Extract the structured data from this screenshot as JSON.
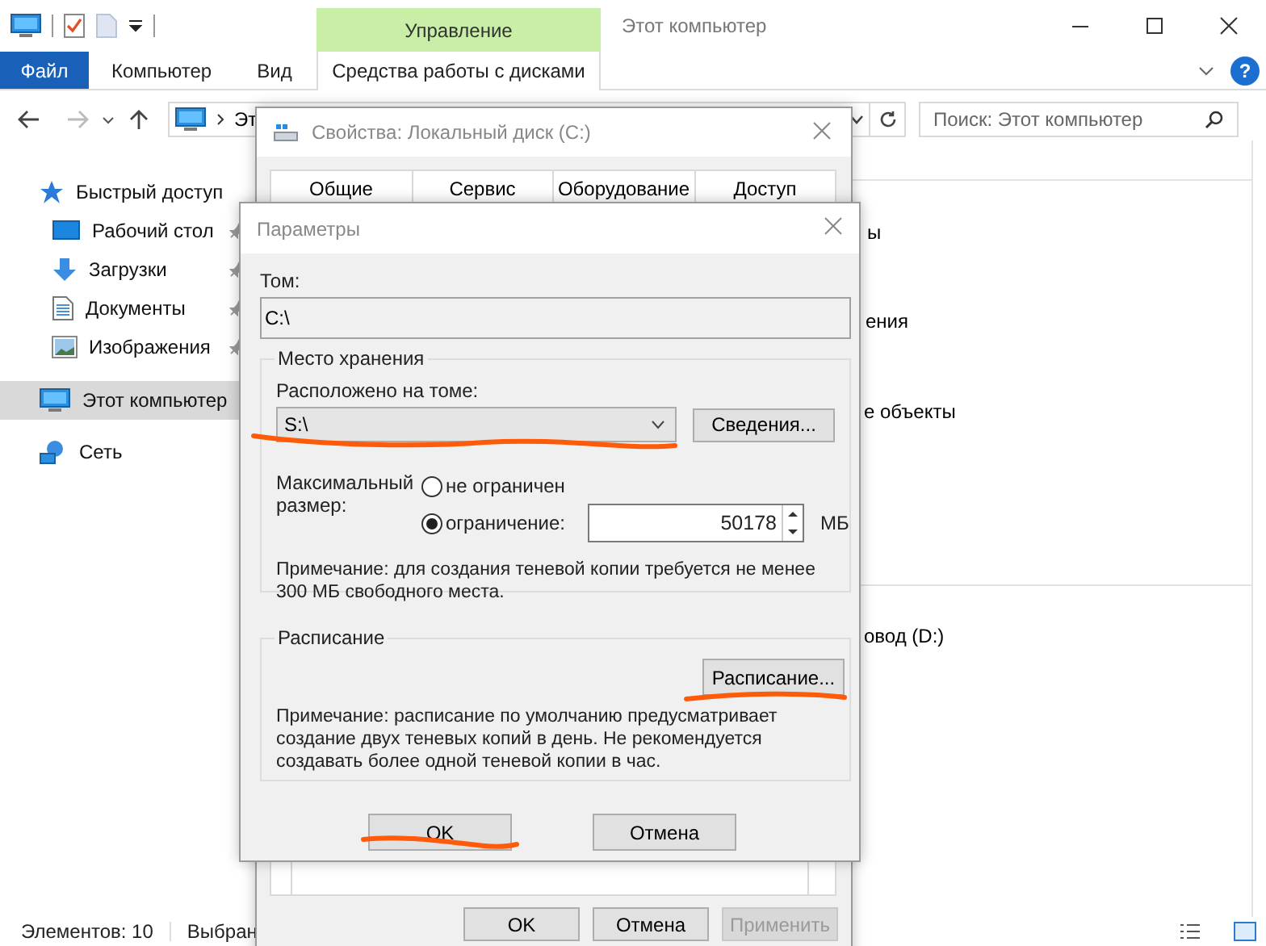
{
  "explorer": {
    "title": "Этот компьютер",
    "context_group": "Управление",
    "ribbon_tabs": [
      {
        "label": "Файл",
        "kind": "file"
      },
      {
        "label": "Компьютер",
        "kind": "tab"
      },
      {
        "label": "Вид",
        "kind": "tab"
      },
      {
        "label": "Средства работы с дисками",
        "kind": "context"
      }
    ],
    "help": "?",
    "address": {
      "crumb": "Эт"
    },
    "search": {
      "placeholder": "Поиск: Этот компьютер"
    },
    "nav": [
      {
        "label": "Быстрый доступ",
        "selected": false,
        "children": [
          {
            "label": "Рабочий стол",
            "selected": false,
            "pinned": true
          },
          {
            "label": "Загрузки",
            "selected": false,
            "pinned": true
          },
          {
            "label": "Документы",
            "selected": false,
            "pinned": true
          },
          {
            "label": "Изображения",
            "selected": false,
            "pinned": true
          }
        ]
      },
      {
        "label": "Этот компьютер",
        "selected": true
      },
      {
        "label": "Сеть",
        "selected": false
      }
    ],
    "content_fragments": [
      "ы",
      "ения",
      "е объекты",
      "овод (D:)"
    ],
    "status": {
      "count": "Элементов: 10",
      "selection": "Выбран"
    }
  },
  "properties_dialog": {
    "title": "Свойства: Локальный диск (C:)",
    "tabs": [
      {
        "label": "Общие"
      },
      {
        "label": "Сервис"
      },
      {
        "label": "Оборудование"
      },
      {
        "label": "Доступ"
      }
    ],
    "buttons": [
      {
        "label": "OK",
        "disabled": false
      },
      {
        "label": "Отмена",
        "disabled": false
      },
      {
        "label": "Применить",
        "disabled": true
      }
    ]
  },
  "params_dialog": {
    "title": "Параметры",
    "volume_label": "Том:",
    "volume": "C:\\",
    "storage": {
      "title": "Место хранения",
      "location_label": "Расположено на томе:",
      "location": "S:\\",
      "details_button": "Сведения...",
      "max_label": "Максимальный размер:",
      "options": [
        {
          "label": "не ограничен",
          "selected": false
        },
        {
          "label": "ограничение:",
          "selected": true
        }
      ],
      "limit": "50178",
      "unit": "МБ",
      "note": "Примечание: для создания теневой копии требуется не менее 300 МБ свободного места."
    },
    "schedule": {
      "title": "Расписание",
      "button": "Расписание...",
      "note": "Примечание: расписание по умолчанию предусматривает создание двух теневых копий в день. Не рекомендуется создавать более одной теневой копии в час."
    },
    "buttons": [
      {
        "label": "OK"
      },
      {
        "label": "Отмена"
      }
    ]
  }
}
